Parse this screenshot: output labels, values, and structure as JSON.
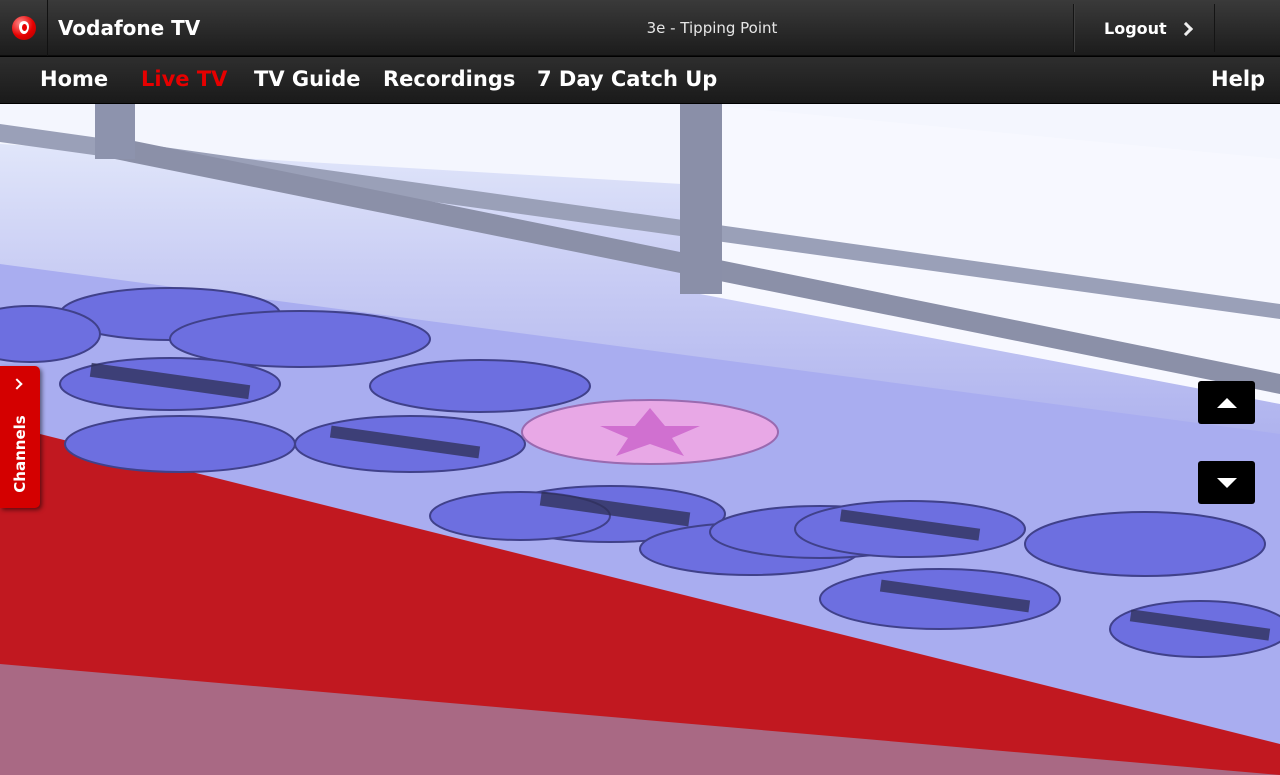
{
  "header": {
    "app_title": "Vodafone TV",
    "now_playing": "3e - Tipping Point",
    "logout_label": "Logout",
    "logo_icon": "vodafone-logo-icon",
    "logout_icon": "chevron-right-icon"
  },
  "nav": {
    "items": [
      {
        "label": "Home",
        "active": false
      },
      {
        "label": "Live TV",
        "active": true
      },
      {
        "label": "TV Guide",
        "active": false
      },
      {
        "label": "Recordings",
        "active": false
      },
      {
        "label": "7 Day Catch Up",
        "active": false
      }
    ],
    "help_label": "Help"
  },
  "sidebar": {
    "channels_label": "Channels",
    "channels_icon": "chevron-right-icon"
  },
  "controls": {
    "up_icon": "triangle-up-icon",
    "down_icon": "triangle-down-icon"
  },
  "colors": {
    "brand_red": "#e60000",
    "active_nav": "#e60000",
    "bar_dark": "#1c1c1c"
  }
}
